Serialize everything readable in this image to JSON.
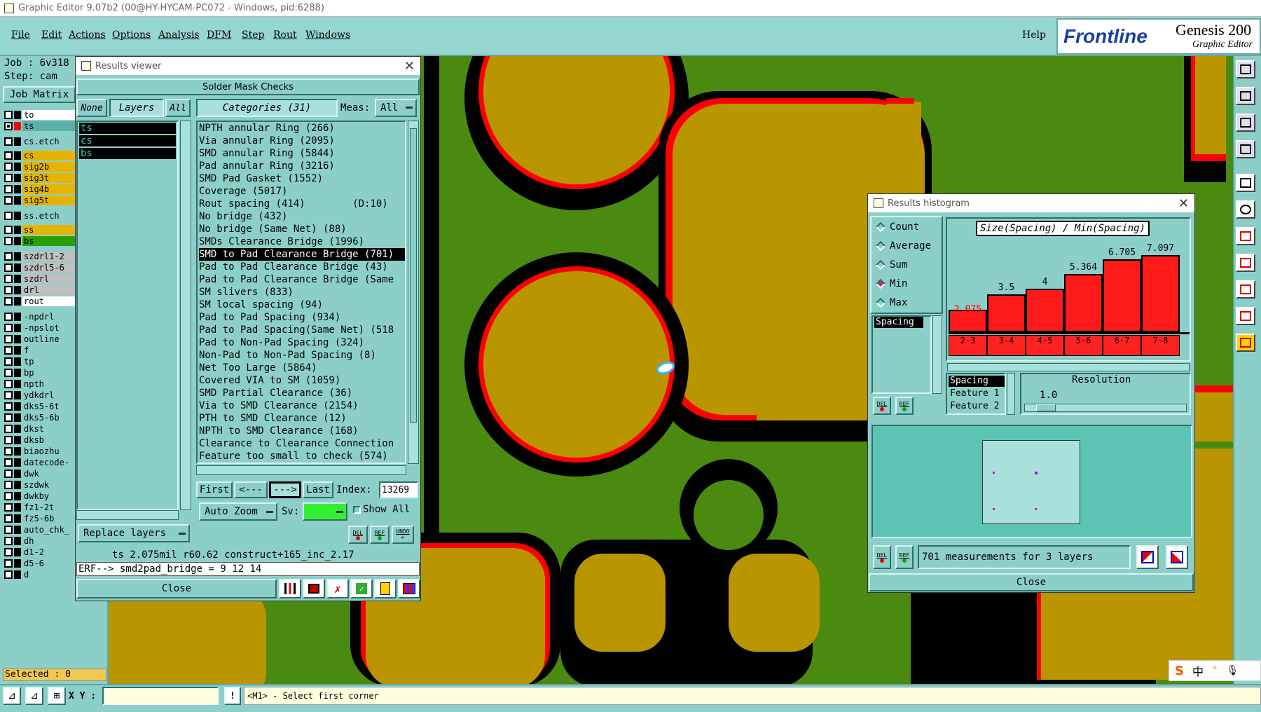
{
  "window": {
    "title": "Graphic Editor 9.07b2 (00@HY-HYCAM-PC072 - Windows, pid:6288)"
  },
  "menu": {
    "items": [
      "File",
      "Edit",
      "Actions",
      "Options",
      "Analysis",
      "DFM",
      "Step",
      "Rout",
      "Windows"
    ],
    "help": "Help",
    "brand": "Frontline",
    "product": "Genesis 200",
    "product_sub": "Graphic Editor"
  },
  "job": {
    "job_label": "Job  : 6v318",
    "step_label": "Step:  cam",
    "matrix_button": "Job Matrix"
  },
  "layers": [
    {
      "name": "to",
      "color": "#ffffff",
      "sw": "#000000"
    },
    {
      "name": "ts",
      "color": "#5ab0a8",
      "sw": "#ff0000"
    },
    {
      "name": "cs.etch",
      "color": "#8ccfc9",
      "sw": "#000000"
    },
    {
      "name": "cs",
      "color": "#e6b400",
      "sw": "#2aa000"
    },
    {
      "name": "sig2b",
      "color": "#e6b400",
      "sw": "#000000"
    },
    {
      "name": "sig3t",
      "color": "#e6b400",
      "sw": "#000000"
    },
    {
      "name": "sig4b",
      "color": "#e6b400",
      "sw": "#000000"
    },
    {
      "name": "sig5t",
      "color": "#e6b400",
      "sw": "#000000"
    },
    {
      "name": "ss.etch",
      "color": "#8ccfc9",
      "sw": "#000000"
    },
    {
      "name": "ss",
      "color": "#e6b400",
      "sw": "#000000"
    },
    {
      "name": "bs",
      "color": "#2aa000",
      "sw": "#000000"
    },
    {
      "name": "szdrl1-2",
      "color": "#bfbfbf",
      "sw": "#000000"
    },
    {
      "name": "szdrl5-6",
      "color": "#bfbfbf",
      "sw": "#000000"
    },
    {
      "name": "szdrl",
      "color": "#bfbfbf",
      "sw": "#000000"
    },
    {
      "name": "drl",
      "color": "#bfbfbf",
      "sw": "#000000"
    },
    {
      "name": "rout",
      "color": "#ffffff",
      "sw": "#000000"
    },
    {
      "name": "-npdrl",
      "color": "#8ccfc9",
      "sw": "#000000"
    },
    {
      "name": "-npslot",
      "color": "#8ccfc9",
      "sw": "#000000"
    },
    {
      "name": "outline",
      "color": "#8ccfc9",
      "sw": "#000000"
    },
    {
      "name": "f",
      "color": "#8ccfc9",
      "sw": "#000000"
    },
    {
      "name": "tp",
      "color": "#8ccfc9",
      "sw": "#000000"
    },
    {
      "name": "bp",
      "color": "#8ccfc9",
      "sw": "#000000"
    },
    {
      "name": "npth",
      "color": "#8ccfc9",
      "sw": "#000000"
    },
    {
      "name": "ydkdrl",
      "color": "#8ccfc9",
      "sw": "#000000"
    },
    {
      "name": "dks5-6t",
      "color": "#8ccfc9",
      "sw": "#000000"
    },
    {
      "name": "dks5-6b",
      "color": "#8ccfc9",
      "sw": "#000000"
    },
    {
      "name": "dkst",
      "color": "#8ccfc9",
      "sw": "#000000"
    },
    {
      "name": "dksb",
      "color": "#8ccfc9",
      "sw": "#000000"
    },
    {
      "name": "biaozhu",
      "color": "#8ccfc9",
      "sw": "#000000"
    },
    {
      "name": "datecode-",
      "color": "#8ccfc9",
      "sw": "#000000"
    },
    {
      "name": "dwk",
      "color": "#8ccfc9",
      "sw": "#000000"
    },
    {
      "name": "szdwk",
      "color": "#8ccfc9",
      "sw": "#000000"
    },
    {
      "name": "dwkby",
      "color": "#8ccfc9",
      "sw": "#000000"
    },
    {
      "name": "fz1-2t",
      "color": "#8ccfc9",
      "sw": "#000000"
    },
    {
      "name": "fz5-6b",
      "color": "#8ccfc9",
      "sw": "#000000"
    },
    {
      "name": "auto_chk_",
      "color": "#8ccfc9",
      "sw": "#000000"
    },
    {
      "name": "dh",
      "color": "#8ccfc9",
      "sw": "#000000"
    },
    {
      "name": "d1-2",
      "color": "#8ccfc9",
      "sw": "#000000"
    },
    {
      "name": "d5-6",
      "color": "#8ccfc9",
      "sw": "#000000"
    },
    {
      "name": "d",
      "color": "#8ccfc9",
      "sw": "#000000"
    }
  ],
  "selected": "Selected : 0",
  "results_viewer": {
    "title": "Results viewer",
    "header": "Solder Mask Checks",
    "none_btn": "None",
    "layers_btn": "Layers",
    "all_btn": "All",
    "categories_label": "Categories (31)",
    "meas_label": "Meas:",
    "meas_value": "All",
    "layer_list": [
      "ts",
      "cs",
      "bs"
    ],
    "categories": [
      "NPTH annular Ring (266)",
      "Via annular Ring (2095)",
      "SMD annular Ring (5844)",
      "Pad annular Ring (3216)",
      "SMD Pad Gasket (1552)",
      "Coverage (5017)",
      "Rout spacing (414)        (D:10)",
      "No bridge (432)",
      "No bridge (Same Net) (88)",
      "SMDs Clearance Bridge (1996)",
      "SMD to Pad Clearance Bridge (701)",
      "Pad to Pad Clearance Bridge (43)",
      "Pad to Pad Clearance Bridge (Same",
      "SM slivers (833)",
      "SM local spacing (94)",
      "Pad to Pad Spacing (934)",
      "Pad to Pad Spacing(Same Net) (518",
      "Pad to Non-Pad Spacing (324)",
      "Non-Pad to Non-Pad Spacing (8)",
      "Net Too Large (5864)",
      "Covered VIA to SM (1059)",
      "SMD Partial Clearance (36)",
      "Via to SMD Clearance (2154)",
      "PTH to SMD Clearance (12)",
      "NPTH to SMD Clearance (168)",
      "Clearance to Clearance Connection",
      "Feature too small to check (574)"
    ],
    "selected_index": 10,
    "first_btn": "First",
    "prev_btn": "<---",
    "next_btn": "--->",
    "last_btn": "Last",
    "index_label": "Index:",
    "index_value": "13269",
    "autozoom_btn": "Auto Zoom",
    "sv_label": "Sv:",
    "show_all_label": "Show All",
    "replace_layers_btn": "Replace layers",
    "del_label": "DEL",
    "ref_label": "REF",
    "undo_label": "UNDO",
    "status_line": "ts 2.075mil  r60.62  construct+165_inc_2.17",
    "erf_line": "ERF--> smd2pad_bridge = 9 12 14",
    "close_btn": "Close"
  },
  "histogram": {
    "title": "Results histogram",
    "modes": [
      "Count",
      "Average",
      "Sum",
      "Min",
      "Max"
    ],
    "selected_mode": "Min",
    "measure_item": "Spacing",
    "chart_title": "Size(Spacing) / Min(Spacing)",
    "del_label": "DEL",
    "ref_label": "REF",
    "axis_items": [
      "Spacing",
      "Feature 1",
      "Feature 2"
    ],
    "resolution_label": "Resolution",
    "resolution_value": "1.0",
    "summary": "701 measurements for 3 layers",
    "close_btn": "Close"
  },
  "chart_data": {
    "type": "bar",
    "title": "Size(Spacing) / Min(Spacing)",
    "categories": [
      "2-3",
      "3-4",
      "4-5",
      "5-6",
      "6-7",
      "7-8"
    ],
    "values": [
      2.075,
      3.5,
      4,
      5.364,
      6.705,
      7.097
    ],
    "ylim": [
      0,
      7.097
    ]
  },
  "bottom": {
    "xy_label": "X Y :",
    "xy_value": "",
    "message": "<M1> - Select first corner"
  },
  "colors": {
    "accent": "#8ccfc9",
    "board_green": "#4a8a10",
    "pad_gold": "#b99600",
    "clearance_red": "#ff0000",
    "bar_red": "#ff1a1a"
  },
  "right_toolbar_icons": [
    "home-icon",
    "panel-icon",
    "fit-icon",
    "layers-icon",
    "lock-icon",
    "mirror-icon",
    "network-icon",
    "measure-icon",
    "snap-icon",
    "triangle-icon",
    "pointer-icon"
  ],
  "ime": {
    "label": "中"
  }
}
